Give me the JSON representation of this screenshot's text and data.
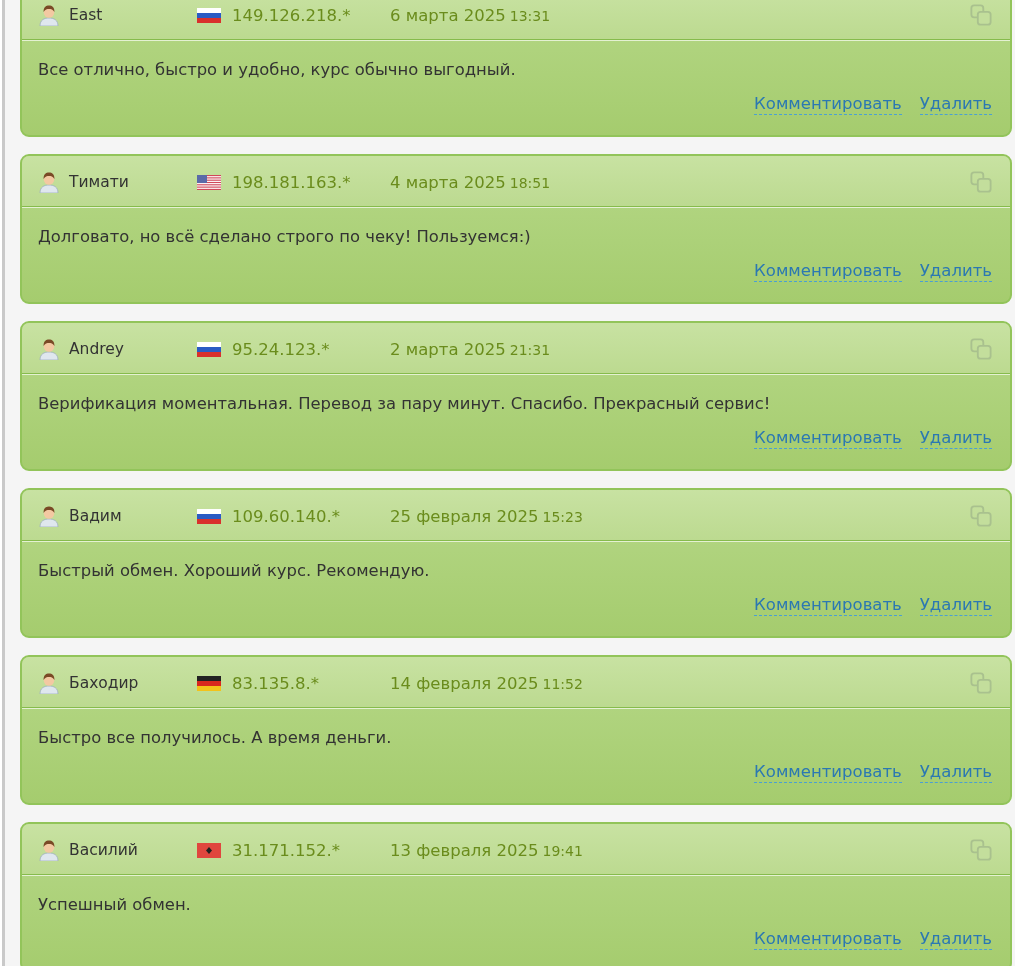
{
  "reviews": [
    {
      "author": "East",
      "flag": {
        "kind": "ru"
      },
      "ip": "149.126.218.*",
      "date": "6 марта 2025",
      "time": "13:31",
      "text": "Все отлично, быстро и удобно, курс обычно выгодный.",
      "actions": [
        {
          "label": "Комментировать"
        },
        {
          "label": "Удалить"
        }
      ]
    },
    {
      "author": "Тимати",
      "flag": {
        "kind": "us"
      },
      "ip": "198.181.163.*",
      "date": "4 марта 2025",
      "time": "18:51",
      "text": "Долговато, но всё сделано строго по чеку! Пользуемся:)",
      "actions": [
        {
          "label": "Комментировать"
        },
        {
          "label": "Удалить"
        }
      ]
    },
    {
      "author": "Andrey",
      "flag": {
        "kind": "ru"
      },
      "ip": "95.24.123.*",
      "date": "2 марта 2025",
      "time": "21:31",
      "text": "Верификация моментальная. Перевод за пару минут. Спасибо. Прекрасный сервис!",
      "actions": [
        {
          "label": "Комментировать"
        },
        {
          "label": "Удалить"
        }
      ]
    },
    {
      "author": "Вадим",
      "flag": {
        "kind": "ru"
      },
      "ip": "109.60.140.*",
      "date": "25 февраля 2025",
      "time": "15:23",
      "text": "Быстрый обмен. Хороший курс. Рекомендую.",
      "actions": [
        {
          "label": "Комментировать"
        },
        {
          "label": "Удалить"
        }
      ]
    },
    {
      "author": "Баходир",
      "flag": {
        "kind": "de"
      },
      "ip": "83.135.8.*",
      "date": "14 февраля 2025",
      "time": "11:52",
      "text": "Быстро все получилось. А время деньги.",
      "actions": [
        {
          "label": "Комментировать"
        },
        {
          "label": "Удалить"
        }
      ]
    },
    {
      "author": "Василий",
      "flag": {
        "kind": "al"
      },
      "ip": "31.171.152.*",
      "date": "13 февраля 2025",
      "time": "19:41",
      "text": "Успешный обмен.",
      "actions": [
        {
          "label": "Комментировать"
        },
        {
          "label": "Удалить"
        }
      ]
    }
  ]
}
